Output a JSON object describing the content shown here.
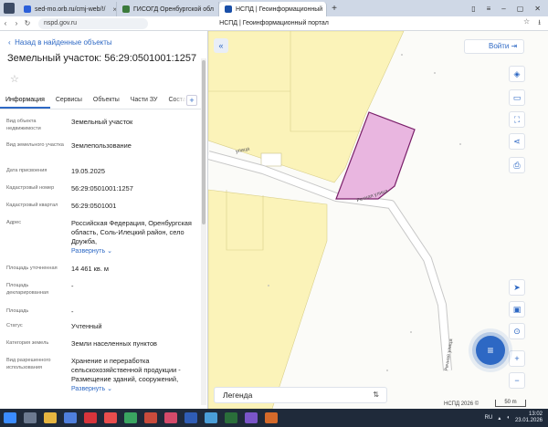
{
  "browser": {
    "tabs": [
      {
        "label": "sed-mo.orb.ru/cmj-web/!/",
        "active": false
      },
      {
        "label": "ГИСОГД Оренбургской обл",
        "active": false
      },
      {
        "label": "НСПД | Геоинформационный",
        "active": true
      }
    ],
    "new_tab": "+",
    "url": "nspd.gov.ru",
    "page_title": "НСПД | Геоинформационный портал"
  },
  "panel": {
    "back_link": "Назад в найденные объекты",
    "title": "Земельный участок: 56:29:0501001:1257",
    "tabs": [
      "Информация",
      "Сервисы",
      "Объекты",
      "Части ЗУ",
      "Состав"
    ],
    "add_tab": "+",
    "expand_label": "Развернуть",
    "rows": [
      {
        "key": "Вид объекта недвижимости",
        "value": "Земельный участок"
      },
      {
        "key": "Вид земельного участка",
        "value": "Землепользование"
      },
      {
        "key": "Дата присвоения",
        "value": "19.05.2025"
      },
      {
        "key": "Кадастровый номер",
        "value": "56:29:0501001:1257"
      },
      {
        "key": "Кадастровый квартал",
        "value": "56:29:0501001"
      },
      {
        "key": "Адрес",
        "value": "Российская Федерация, Оренбургская область, Соль-Илецкий район, село Дружба,"
      },
      {
        "key": "Площадь уточненная",
        "value": "14 461 кв. м"
      },
      {
        "key": "Площадь декларированная",
        "value": "-"
      },
      {
        "key": "Площадь",
        "value": "-"
      },
      {
        "key": "Статус",
        "value": "Учтенный"
      },
      {
        "key": "Категория земель",
        "value": "Земли населенных пунктов"
      },
      {
        "key": "Вид разрешенного использования",
        "value": "Хранение и переработка сельскохозяйственной продукции - Размещение зданий, сооружений,"
      }
    ]
  },
  "map": {
    "login_label": "Войти",
    "legend_label": "Легенда",
    "copyright": "НСПД 2026 ©",
    "scale": "50 m",
    "road_labels": [
      "улица",
      "Речная улица",
      "Речная улица"
    ],
    "parcel_fill": "#e9b6e0",
    "parcel_stroke": "#7a1f6a",
    "zone_fill": "#fbf3b9",
    "accent": "#2d68c4"
  },
  "taskbar": {
    "lang": "RU",
    "time": "13:02",
    "date": "23.01.2026"
  }
}
